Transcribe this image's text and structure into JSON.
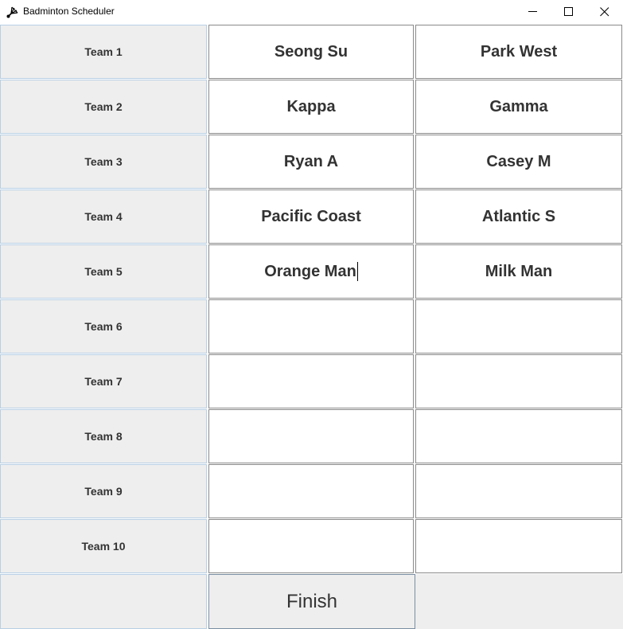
{
  "window": {
    "title": "Badminton Scheduler",
    "app_icon": "shuttlecock-icon",
    "controls": [
      "minimize-icon",
      "maximize-icon",
      "close-icon"
    ]
  },
  "rows": [
    {
      "label": "Team 1",
      "player1": "Seong Su",
      "player2": "Park West"
    },
    {
      "label": "Team 2",
      "player1": "Kappa",
      "player2": "Gamma"
    },
    {
      "label": "Team 3",
      "player1": "Ryan A",
      "player2": "Casey M"
    },
    {
      "label": "Team 4",
      "player1": "Pacific Coast",
      "player2": "Atlantic S"
    },
    {
      "label": "Team 5",
      "player1": "Orange Man",
      "player2": "Milk Man"
    },
    {
      "label": "Team 6",
      "player1": "",
      "player2": ""
    },
    {
      "label": "Team 7",
      "player1": "",
      "player2": ""
    },
    {
      "label": "Team 8",
      "player1": "",
      "player2": ""
    },
    {
      "label": "Team 9",
      "player1": "",
      "player2": ""
    },
    {
      "label": "Team 10",
      "player1": "",
      "player2": ""
    }
  ],
  "finish_label": "Finish",
  "colors": {
    "label_bg": "#eeeeee",
    "label_border": "#b8cfe5",
    "field_border": "#8a8a8a",
    "text": "#333333"
  }
}
